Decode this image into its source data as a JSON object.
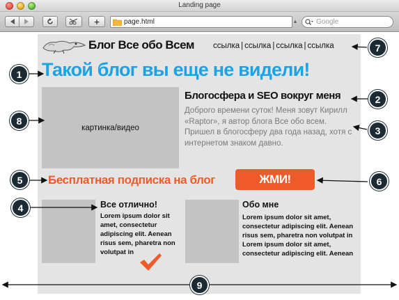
{
  "window": {
    "title": "Landing page",
    "url": "page.html",
    "search_placeholder": "Google"
  },
  "header": {
    "blog_name": "Блог Все обо Всем",
    "nav_links": [
      "ссылка",
      "ссылка",
      "ссылка",
      "ссылка"
    ]
  },
  "hero": {
    "headline": "Такой блог вы еще не видели!",
    "media_label": "картинка/видео",
    "section_title": "Блогосфера и SEO вокруг меня",
    "section_text": "Доброго времени суток! Меня зовут Кирилл «Raptor»,  я автор блога Все обо всем. Пришел в блогосферу два года назад, хотя с интернетом знаком давно."
  },
  "subscribe": {
    "text": "Бесплатная подписка на блог",
    "button": "ЖМИ!"
  },
  "columns": [
    {
      "title": "Все отлично!",
      "text": "Lorem ipsum dolor sit amet, consectetur adipiscing elit. Aenean risus sem, pharetra non volutpat in"
    },
    {
      "title": "Обо мне",
      "text": "Lorem ipsum dolor sit amet, consectetur adipiscing elit. Aenean risus sem, pharetra non volutpat in Lorem ipsum dolor sit amet, consectetur adipiscing elit. Aenean"
    }
  ],
  "annotations": [
    "1",
    "2",
    "3",
    "4",
    "5",
    "6",
    "7",
    "8",
    "9"
  ],
  "colors": {
    "accent_blue": "#1ca3e4",
    "accent_orange": "#ef5a2a",
    "canvas_gray": "#e4e4e4",
    "placeholder_gray": "#c3c3c3",
    "badge_dark": "#1c2a33"
  }
}
